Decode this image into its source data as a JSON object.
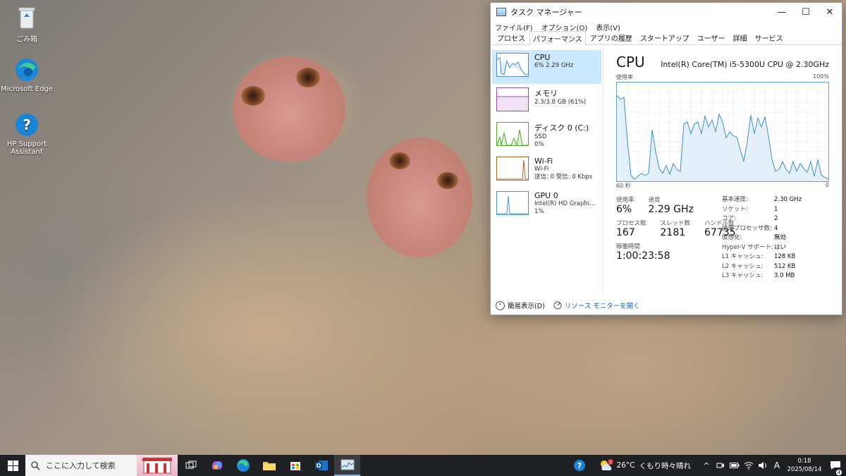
{
  "desktop": {
    "icons": [
      {
        "label": "ごみ箱"
      },
      {
        "label": "Microsoft Edge"
      },
      {
        "label": "HP Support Assistant"
      }
    ]
  },
  "window": {
    "title": "タスク マネージャー",
    "controls": {
      "minimize": "—",
      "maximize": "☐",
      "close": "✕"
    },
    "menu": [
      "ファイル(F)",
      "オプション(O)",
      "表示(V)"
    ],
    "tabs": [
      "プロセス",
      "パフォーマンス",
      "アプリの履歴",
      "スタートアップ",
      "ユーザー",
      "詳細",
      "サービス"
    ],
    "active_tab": "パフォーマンス"
  },
  "resources": [
    {
      "name": "CPU",
      "sub1": "6%  2.29 GHz",
      "sub2": "",
      "sub3": "",
      "color": "#4a90c9"
    },
    {
      "name": "メモリ",
      "sub1": "2.3/3.8 GB (61%)",
      "sub2": "",
      "sub3": "",
      "color": "#9b4bab"
    },
    {
      "name": "ディスク 0 (C:)",
      "sub1": "SSD",
      "sub2": "0%",
      "sub3": "",
      "color": "#4ea72e"
    },
    {
      "name": "Wi-Fi",
      "sub1": "Wi-Fi",
      "sub2": "送信: 0  受信: 0 Kbps",
      "sub3": "",
      "color": "#b5651d"
    },
    {
      "name": "GPU 0",
      "sub1": "Intel(R) HD Graphi...",
      "sub2": "1%",
      "sub3": "",
      "color": "#4a90c9"
    }
  ],
  "detail": {
    "title": "CPU",
    "model": "Intel(R) Core(TM) i5-5300U CPU @ 2.30GHz",
    "graph_label_top_left": "使用率",
    "graph_label_top_right": "100%",
    "graph_label_bottom_left": "60 秒",
    "graph_label_bottom_right": "0",
    "stats": {
      "usage_label": "使用率",
      "usage_value": "6%",
      "speed_label": "速度",
      "speed_value": "2.29 GHz",
      "processes_label": "プロセス数",
      "processes_value": "167",
      "threads_label": "スレッド数",
      "threads_value": "2181",
      "handles_label": "ハンドル数",
      "handles_value": "67735",
      "uptime_label": "稼働時間",
      "uptime_value": "1:00:23:58"
    },
    "specs": [
      {
        "k": "基本速度:",
        "v": "2.30 GHz"
      },
      {
        "k": "ソケット:",
        "v": "1"
      },
      {
        "k": "コア:",
        "v": "2"
      },
      {
        "k": "論理プロセッサ数:",
        "v": "4"
      },
      {
        "k": "仮想化:",
        "v": "無効"
      },
      {
        "k": "Hyper-V サポート:",
        "v": "はい"
      },
      {
        "k": "L1 キャッシュ:",
        "v": "128 KB"
      },
      {
        "k": "L2 キャッシュ:",
        "v": "512 KB"
      },
      {
        "k": "L3 キャッシュ:",
        "v": "3.0 MB"
      }
    ]
  },
  "chart_data": {
    "type": "area",
    "title": "",
    "xlabel": "",
    "ylabel": "使用率",
    "ylim": [
      0,
      100
    ],
    "xlim": [
      60,
      0
    ],
    "x": [
      60,
      59,
      58,
      57,
      56,
      55,
      54,
      53,
      52,
      51,
      50,
      49,
      48,
      47,
      46,
      45,
      44,
      43,
      42,
      41,
      40,
      39,
      38,
      37,
      36,
      35,
      34,
      33,
      32,
      31,
      30,
      29,
      28,
      27,
      26,
      25,
      24,
      23,
      22,
      21,
      20,
      19,
      18,
      17,
      16,
      15,
      14,
      13,
      12,
      11,
      10,
      9,
      8,
      7,
      6,
      5,
      4,
      3,
      2,
      1,
      0
    ],
    "values": [
      87,
      83,
      85,
      40,
      6,
      2,
      5,
      8,
      6,
      8,
      52,
      30,
      13,
      8,
      16,
      7,
      18,
      12,
      10,
      58,
      60,
      48,
      58,
      60,
      48,
      66,
      55,
      62,
      50,
      68,
      60,
      44,
      50,
      46,
      45,
      32,
      20,
      40,
      67,
      48,
      64,
      55,
      65,
      46,
      22,
      10,
      12,
      20,
      12,
      8,
      20,
      10,
      18,
      13,
      9,
      20,
      5,
      22,
      6,
      4,
      2
    ],
    "series": [
      {
        "name": "",
        "values": []
      }
    ],
    "grid": true
  },
  "footer": {
    "collapse_label": "簡易表示(D)",
    "monitor_label": "リソース モニターを開く"
  },
  "taskbar": {
    "search_placeholder": "ここに入力して検索",
    "weather_temp": "26°C",
    "weather_text": "くもり時々晴れ",
    "weather_badge": "2",
    "ime": "A",
    "time": "0:18",
    "date": "2025/08/14",
    "notification_count": "4"
  }
}
